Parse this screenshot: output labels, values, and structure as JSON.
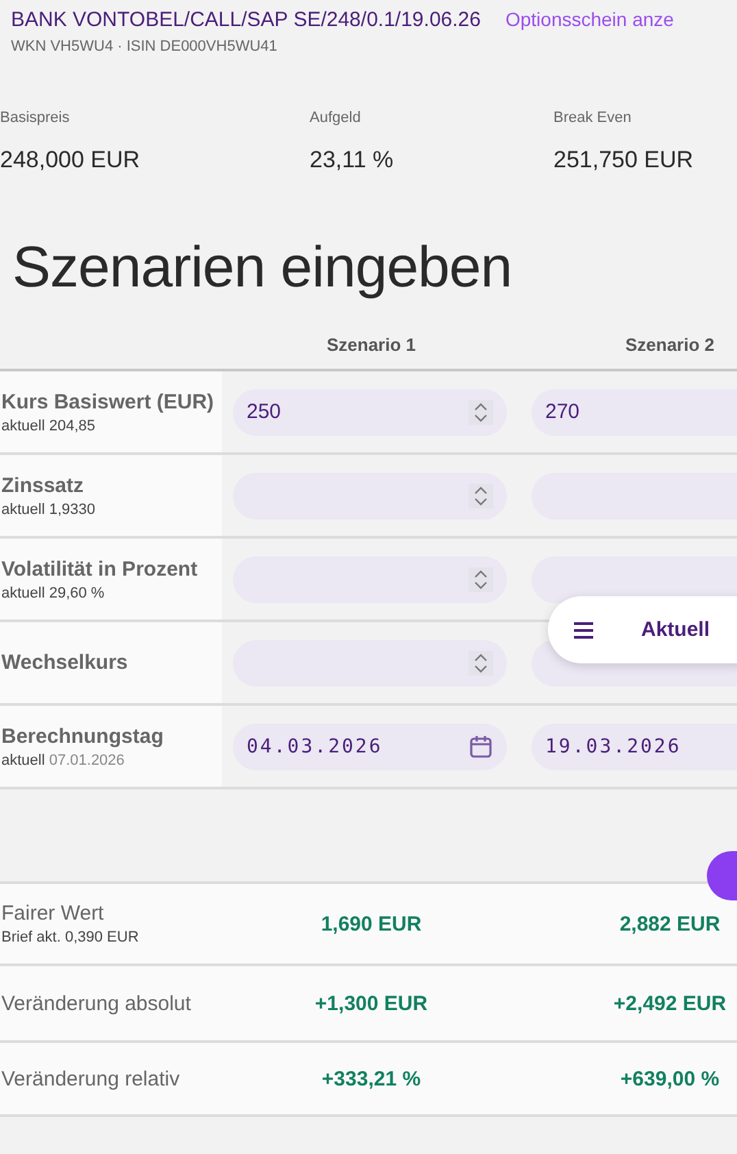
{
  "header": {
    "title": "BANK VONTOBEL/CALL/SAP SE/248/0.1/19.06.26",
    "link": "Optionsschein anze",
    "subtitle": "WKN VH5WU4 · ISIN DE000VH5WU41"
  },
  "stats": [
    {
      "label": "Basispreis",
      "value": "248,000 EUR"
    },
    {
      "label": "Aufgeld",
      "value": "23,11 %"
    },
    {
      "label": "Break Even",
      "value": "251,750 EUR"
    }
  ],
  "heading": "Szenarien eingeben",
  "scenarios": [
    "Szenario 1",
    "Szenario 2"
  ],
  "inputs": [
    {
      "label": "Kurs Basiswert (EUR)",
      "note": "aktuell 204,85",
      "kind": "number",
      "values": [
        {
          "value": "250"
        },
        {
          "value": "270"
        }
      ]
    },
    {
      "label": "Zinssatz",
      "note": "aktuell 1,9330",
      "kind": "number"
    },
    {
      "label": "Volatilität in Prozent",
      "note": "aktuell 29,60 %",
      "kind": "number"
    },
    {
      "label": "Wechselkurs",
      "kind": "number"
    },
    {
      "label": "Berechnungstag",
      "note_prefix": "aktuell",
      "note_value": "07.01.2026",
      "kind": "date",
      "values": [
        {
          "value": "04.03.2026"
        },
        {
          "value": "19.03.2026"
        }
      ]
    }
  ],
  "floating_button": {
    "label": "Aktuell"
  },
  "results": [
    {
      "label": "Fairer Wert",
      "note": "Brief akt. 0,390 EUR",
      "values": [
        "1,690 EUR",
        "2,882 EUR"
      ]
    },
    {
      "label": "Veränderung absolut",
      "values": [
        "+1,300 EUR",
        "+2,492 EUR"
      ]
    },
    {
      "label": "Veränderung relativ",
      "values": [
        "+333,21 %",
        "+639,00 %"
      ]
    }
  ]
}
